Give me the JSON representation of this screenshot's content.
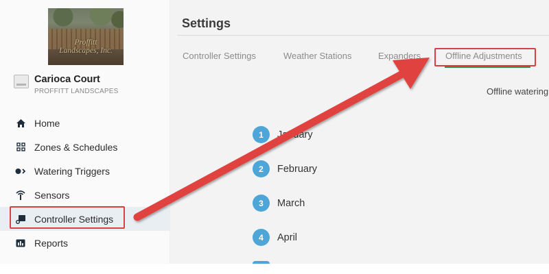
{
  "sidebar": {
    "logo": {
      "line1": "Proffitt",
      "line2": "Landscapes, Inc."
    },
    "site": {
      "name": "Carioca Court",
      "company": "PROFFITT LANDSCAPES"
    },
    "items": [
      {
        "label": "Home",
        "icon": "home-icon"
      },
      {
        "label": "Zones & Schedules",
        "icon": "zones-icon"
      },
      {
        "label": "Watering Triggers",
        "icon": "triggers-icon"
      },
      {
        "label": "Sensors",
        "icon": "sensor-icon"
      },
      {
        "label": "Controller Settings",
        "icon": "controller-icon",
        "active": true
      },
      {
        "label": "Reports",
        "icon": "reports-icon"
      }
    ]
  },
  "main": {
    "title": "Settings",
    "tabs": [
      {
        "label": "Controller Settings"
      },
      {
        "label": "Weather Stations"
      },
      {
        "label": "Expanders"
      },
      {
        "label": "Offline Adjustments",
        "active": true
      }
    ],
    "offline_note": "Offline watering",
    "months": [
      {
        "num": "1",
        "label": "January"
      },
      {
        "num": "2",
        "label": "February"
      },
      {
        "num": "3",
        "label": "March"
      },
      {
        "num": "4",
        "label": "April"
      }
    ]
  },
  "colors": {
    "annotation_red": "#d9413f",
    "badge_blue": "#4ea6d8",
    "tab_underline_green": "#2f8d46"
  }
}
